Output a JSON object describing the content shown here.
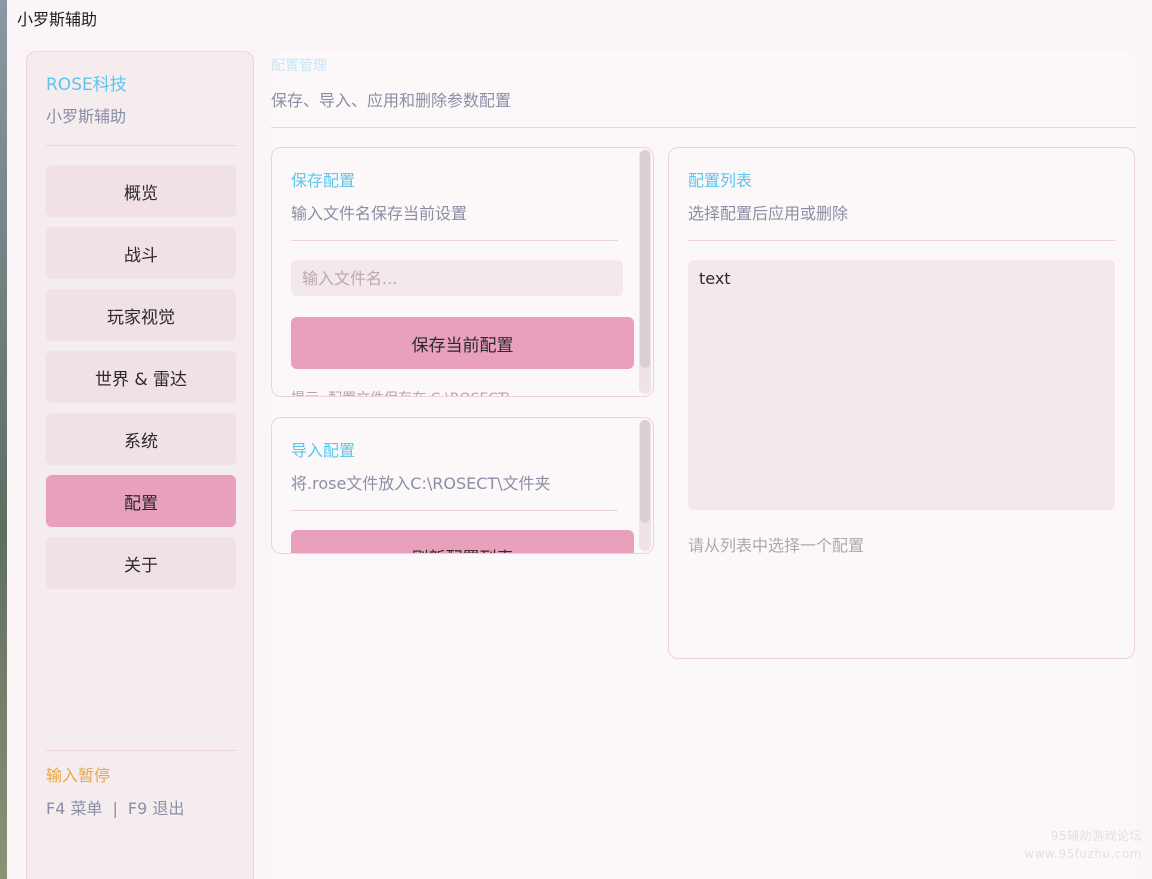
{
  "window": {
    "title": "小罗斯辅助"
  },
  "sidebar": {
    "brand": "ROSE科技",
    "subtitle": "小罗斯辅助",
    "items": [
      {
        "label": "概览"
      },
      {
        "label": "战斗"
      },
      {
        "label": "玩家视觉"
      },
      {
        "label": "世界 & 雷达"
      },
      {
        "label": "系统"
      },
      {
        "label": "配置",
        "active": true
      },
      {
        "label": "关于"
      }
    ],
    "pause_label": "输入暂停",
    "shortcut_menu": "F4 菜单",
    "shortcut_sep": "|",
    "shortcut_exit": "F9 退出"
  },
  "main": {
    "title": "配置管理",
    "subtitle": "保存、导入、应用和删除参数配置"
  },
  "save_card": {
    "title": "保存配置",
    "subtitle": "输入文件名保存当前设置",
    "input_placeholder": "输入文件名...",
    "input_value": "",
    "button_label": "保存当前配置",
    "hint": "提示: 配置文件保存在 C:\\ROSECT\\"
  },
  "import_card": {
    "title": "导入配置",
    "subtitle": "将.rose文件放入C:\\ROSECT\\文件夹",
    "button_label": "刷新配置列表"
  },
  "list_card": {
    "title": "配置列表",
    "subtitle": "选择配置后应用或删除",
    "items": [
      "text"
    ],
    "hint": "请从列表中选择一个配置"
  },
  "watermark": {
    "line1": "95辅助游戏论坛",
    "line2": "www.95fuzhu.com"
  },
  "colors": {
    "accent_blue": "#5cc6ea",
    "accent_pink": "#e8a0bc",
    "accent_orange": "#f0a53c"
  }
}
